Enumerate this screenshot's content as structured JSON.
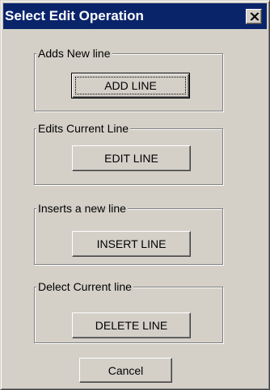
{
  "window": {
    "title": "Select Edit Operation",
    "close_icon": "close-icon"
  },
  "groups": [
    {
      "label": "Adds New line",
      "button": "ADD LINE",
      "default": true
    },
    {
      "label": "Edits Current Line",
      "button": "EDIT LINE"
    },
    {
      "label": "Inserts a new line",
      "button": "INSERT LINE"
    },
    {
      "label": "Delect Current line",
      "button": "DELETE LINE"
    }
  ],
  "cancel_label": "Cancel",
  "colors": {
    "face": "#d4d0c8",
    "titlebar": "#0a246a",
    "title_text": "#ffffff"
  }
}
